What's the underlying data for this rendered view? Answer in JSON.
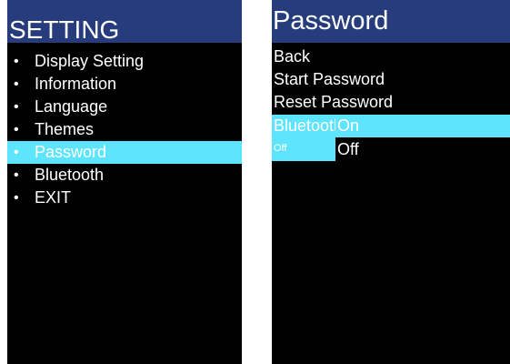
{
  "left_screen": {
    "title": "SETTING",
    "bullet": "•",
    "items": [
      {
        "label": "Display Setting"
      },
      {
        "label": "Information"
      },
      {
        "label": "Language"
      },
      {
        "label": "Themes"
      },
      {
        "label": "Password",
        "selected": true
      },
      {
        "label": "Bluetooth"
      },
      {
        "label": "EXIT"
      }
    ]
  },
  "right_screen": {
    "title": "Password",
    "items": [
      {
        "label": "Back"
      },
      {
        "label": "Start Password"
      },
      {
        "label": "Reset Password"
      }
    ],
    "bluetooth_row": {
      "label": "Bluetooth",
      "sub_value": "Off",
      "options": [
        "On",
        "Off"
      ],
      "highlighted_option": "On"
    }
  },
  "colors": {
    "title_bar": "#263c7d",
    "highlight": "#5ee4fd",
    "screen_bg": "#000000",
    "text": "#ffffff"
  }
}
